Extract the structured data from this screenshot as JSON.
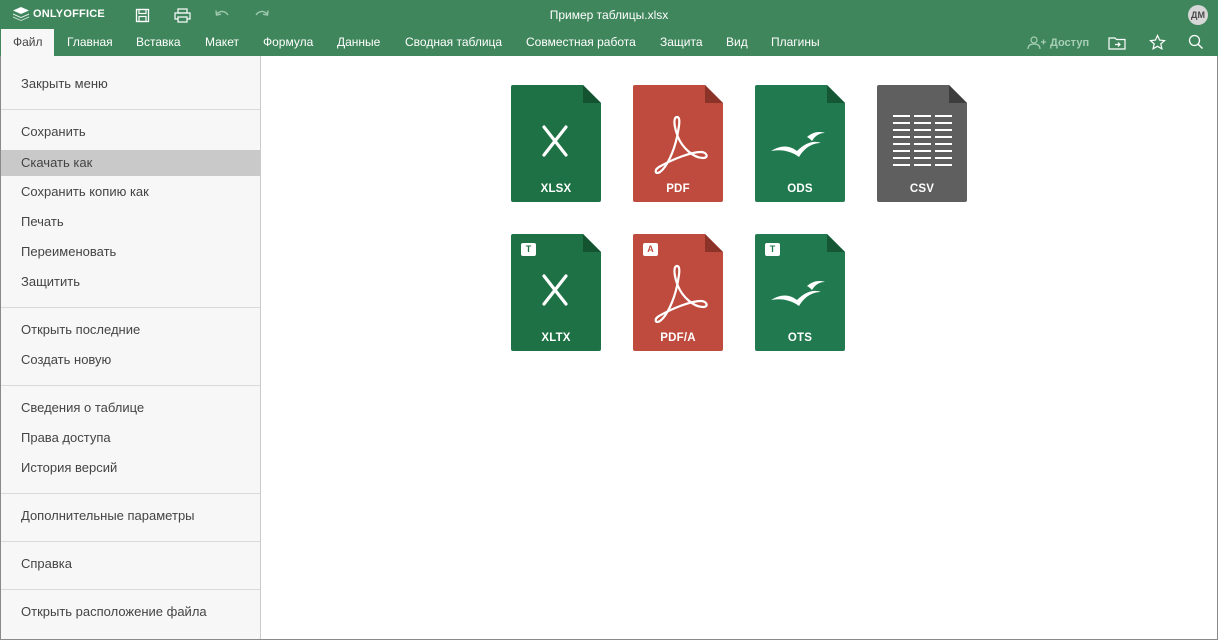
{
  "app": {
    "name": "ONLYOFFICE",
    "doc_title": "Пример таблицы.xlsx",
    "avatar_initials": "ДМ",
    "accent": "#40865c"
  },
  "tabs": [
    {
      "label": "Файл",
      "active": true
    },
    {
      "label": "Главная"
    },
    {
      "label": "Вставка"
    },
    {
      "label": "Макет"
    },
    {
      "label": "Формула"
    },
    {
      "label": "Данные"
    },
    {
      "label": "Сводная таблица"
    },
    {
      "label": "Совместная работа"
    },
    {
      "label": "Защита"
    },
    {
      "label": "Вид"
    },
    {
      "label": "Плагины"
    }
  ],
  "toolbar_right": {
    "share_label": "Доступ"
  },
  "file_menu": [
    {
      "label": "Закрыть меню"
    },
    {
      "label": "Сохранить"
    },
    {
      "label": "Скачать как",
      "selected": true
    },
    {
      "label": "Сохранить копию как"
    },
    {
      "label": "Печать"
    },
    {
      "label": "Переименовать"
    },
    {
      "label": "Защитить"
    },
    {
      "label": "Открыть последние"
    },
    {
      "label": "Создать новую"
    },
    {
      "label": "Сведения о таблице"
    },
    {
      "label": "Права доступа"
    },
    {
      "label": "История версий"
    },
    {
      "label": "Дополнительные параметры"
    },
    {
      "label": "Справка"
    },
    {
      "label": "Открыть расположение файла"
    }
  ],
  "formats": [
    {
      "label": "XLSX",
      "color": "#1e7145",
      "icon": "excel-x-icon"
    },
    {
      "label": "PDF",
      "color": "#bf4b3e",
      "icon": "acrobat-icon"
    },
    {
      "label": "ODS",
      "color": "#217a4f",
      "icon": "seagull-icon"
    },
    {
      "label": "CSV",
      "color": "#5f5f5f",
      "icon": "csv-lines-icon"
    },
    {
      "label": "XLTX",
      "color": "#1e7145",
      "icon": "excel-x-icon",
      "badge": "T"
    },
    {
      "label": "PDF/A",
      "color": "#bf4b3e",
      "icon": "acrobat-icon",
      "badge": "A"
    },
    {
      "label": "OTS",
      "color": "#217a4f",
      "icon": "seagull-icon",
      "badge": "T"
    }
  ]
}
